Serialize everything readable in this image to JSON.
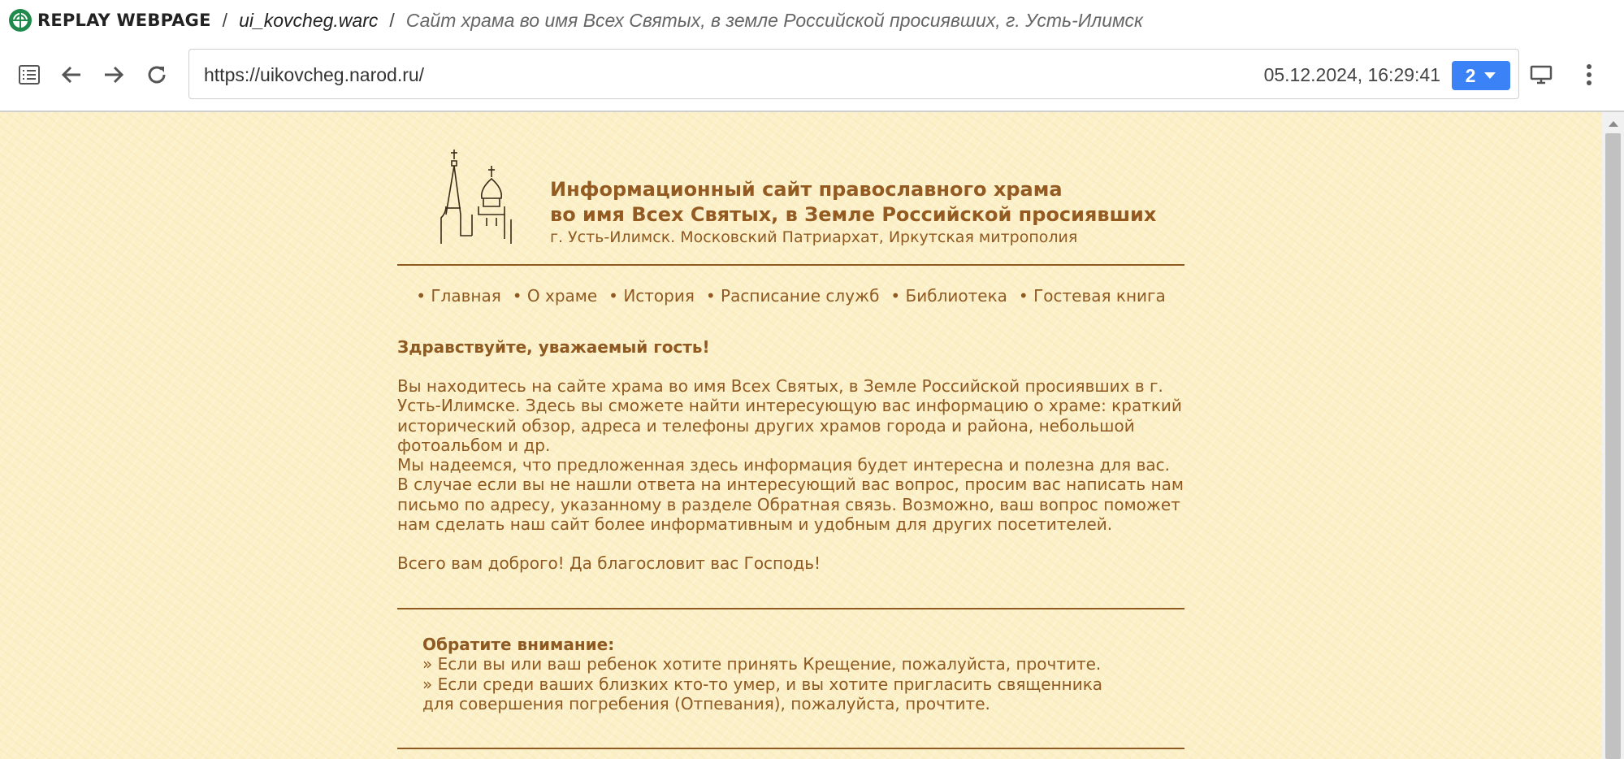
{
  "replay": {
    "brand": "REPLAY WEBPAGE",
    "separator": "/",
    "archive_file": "ui_kovcheg.warc",
    "page_title": "Сайт храма во имя Всех Святых, в земле Российской просиявших, г. Усть-Илимск",
    "url": "https://uikovcheg.narod.ru/",
    "timestamp": "05.12.2024, 16:29:41",
    "version_count": "2",
    "accent_color": "#3b82f6"
  },
  "site": {
    "title_line1": "Информационный сайт православного храма",
    "title_line2": "во имя Всех Святых, в Земле Российской просиявших",
    "subtitle": "г. Усть-Илимск. Московский Патриархат, Иркутская митрополия",
    "text_color": "#8e5a22",
    "background_color": "#fbf0c8",
    "menu": [
      "• Главная",
      "• О храме",
      "• История",
      "• Расписание служб",
      "• Библиотека",
      "• Гостевая книга"
    ],
    "greeting": "Здравствуйте, уважаемый гость!",
    "paragraph1": "Вы находитесь на сайте храма во имя Всех Святых, в Земле Российской просиявших в г. Усть-Илимске. Здесь вы сможете найти интересующую вас информацию о храме: краткий исторический обзор, адреса и телефоны других храмов города и района, небольшой фотоальбом и др.",
    "paragraph2": "Мы надеемся, что предложенная здесь информация будет интересна и полезна для вас. В случае если вы не нашли ответа на интересующий вас вопрос, просим вас написать нам письмо по адресу, указанному в разделе Обратная связь. Возможно, ваш вопрос поможет нам сделать наш сайт более информативным и удобным для других посетителей.",
    "paragraph3": "Всего вам доброго! Да благословит вас Господь!",
    "notice_title": "Обратите внимание:",
    "notice_items": [
      "» Если вы или ваш ребенок хотите принять Крещение, пожалуйста, прочтите.",
      "» Если среди ваших близких кто-то умер, и вы хотите пригласить священника для совершения погребения (Отпевания), пожалуйста, прочтите."
    ]
  }
}
